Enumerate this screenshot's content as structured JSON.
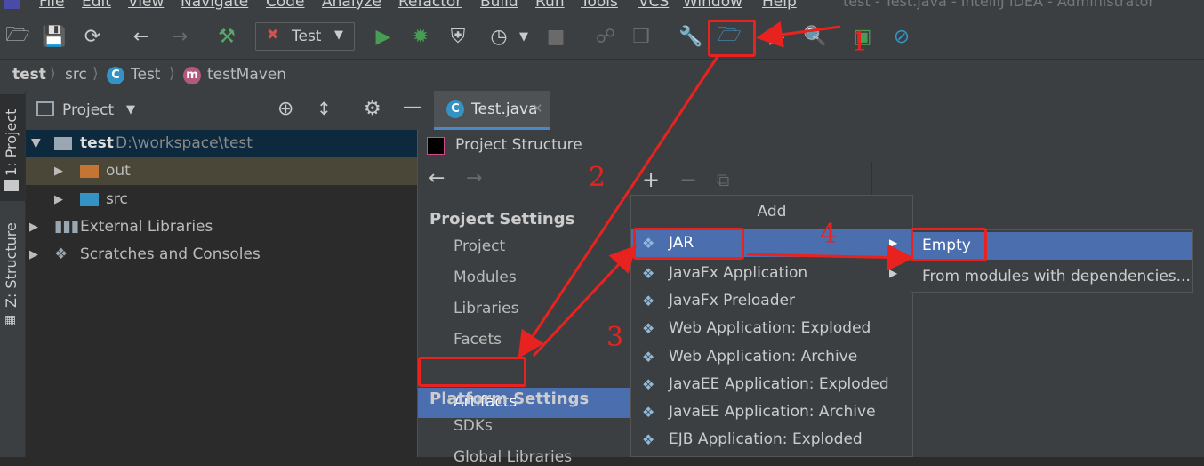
{
  "menubar": {
    "items": [
      "File",
      "Edit",
      "View",
      "Navigate",
      "Code",
      "Analyze",
      "Refactor",
      "Build",
      "Run",
      "Tools",
      "VCS",
      "Window",
      "Help"
    ],
    "window_title": "test - Test.java - IntelliJ IDEA - Administrator"
  },
  "toolbar": {
    "run_config": "Test"
  },
  "breadcrumb": {
    "items": [
      "test",
      "src",
      "Test",
      "testMaven"
    ]
  },
  "stripe": {
    "project": "1: Project",
    "structure": "Z: Structure"
  },
  "project_panel": {
    "title": "Project",
    "tree": [
      {
        "name": "test",
        "path": "D:\\workspace\\test"
      },
      {
        "name": "out"
      },
      {
        "name": "src"
      },
      {
        "name": "External Libraries"
      },
      {
        "name": "Scratches and Consoles"
      }
    ]
  },
  "editor": {
    "tab": "Test.java"
  },
  "dialog": {
    "title": "Project Structure",
    "project_settings": "Project Settings",
    "nav_items": [
      "Project",
      "Modules",
      "Libraries",
      "Facets",
      "Artifacts"
    ],
    "platform_settings": "Platform Settings",
    "platform_items": [
      "SDKs",
      "Global Libraries"
    ]
  },
  "add_menu": {
    "title": "Add",
    "items": [
      "JAR",
      "JavaFx Application",
      "JavaFx Preloader",
      "Web Application: Exploded",
      "Web Application: Archive",
      "JavaEE Application: Exploded",
      "JavaEE Application: Archive",
      "EJB Application: Exploded"
    ]
  },
  "submenu": {
    "items": [
      "Empty",
      "From modules with dependencies..."
    ]
  },
  "annotations": {
    "numbers": [
      "1",
      "2",
      "3",
      "4"
    ],
    "color": "#e8231f"
  },
  "colors": {
    "selection": "#4b6eaf",
    "tree_selection": "#0d293e",
    "accent_green": "#499c54",
    "folder_orange": "#c57533",
    "folder_blue": "#3592c4"
  }
}
